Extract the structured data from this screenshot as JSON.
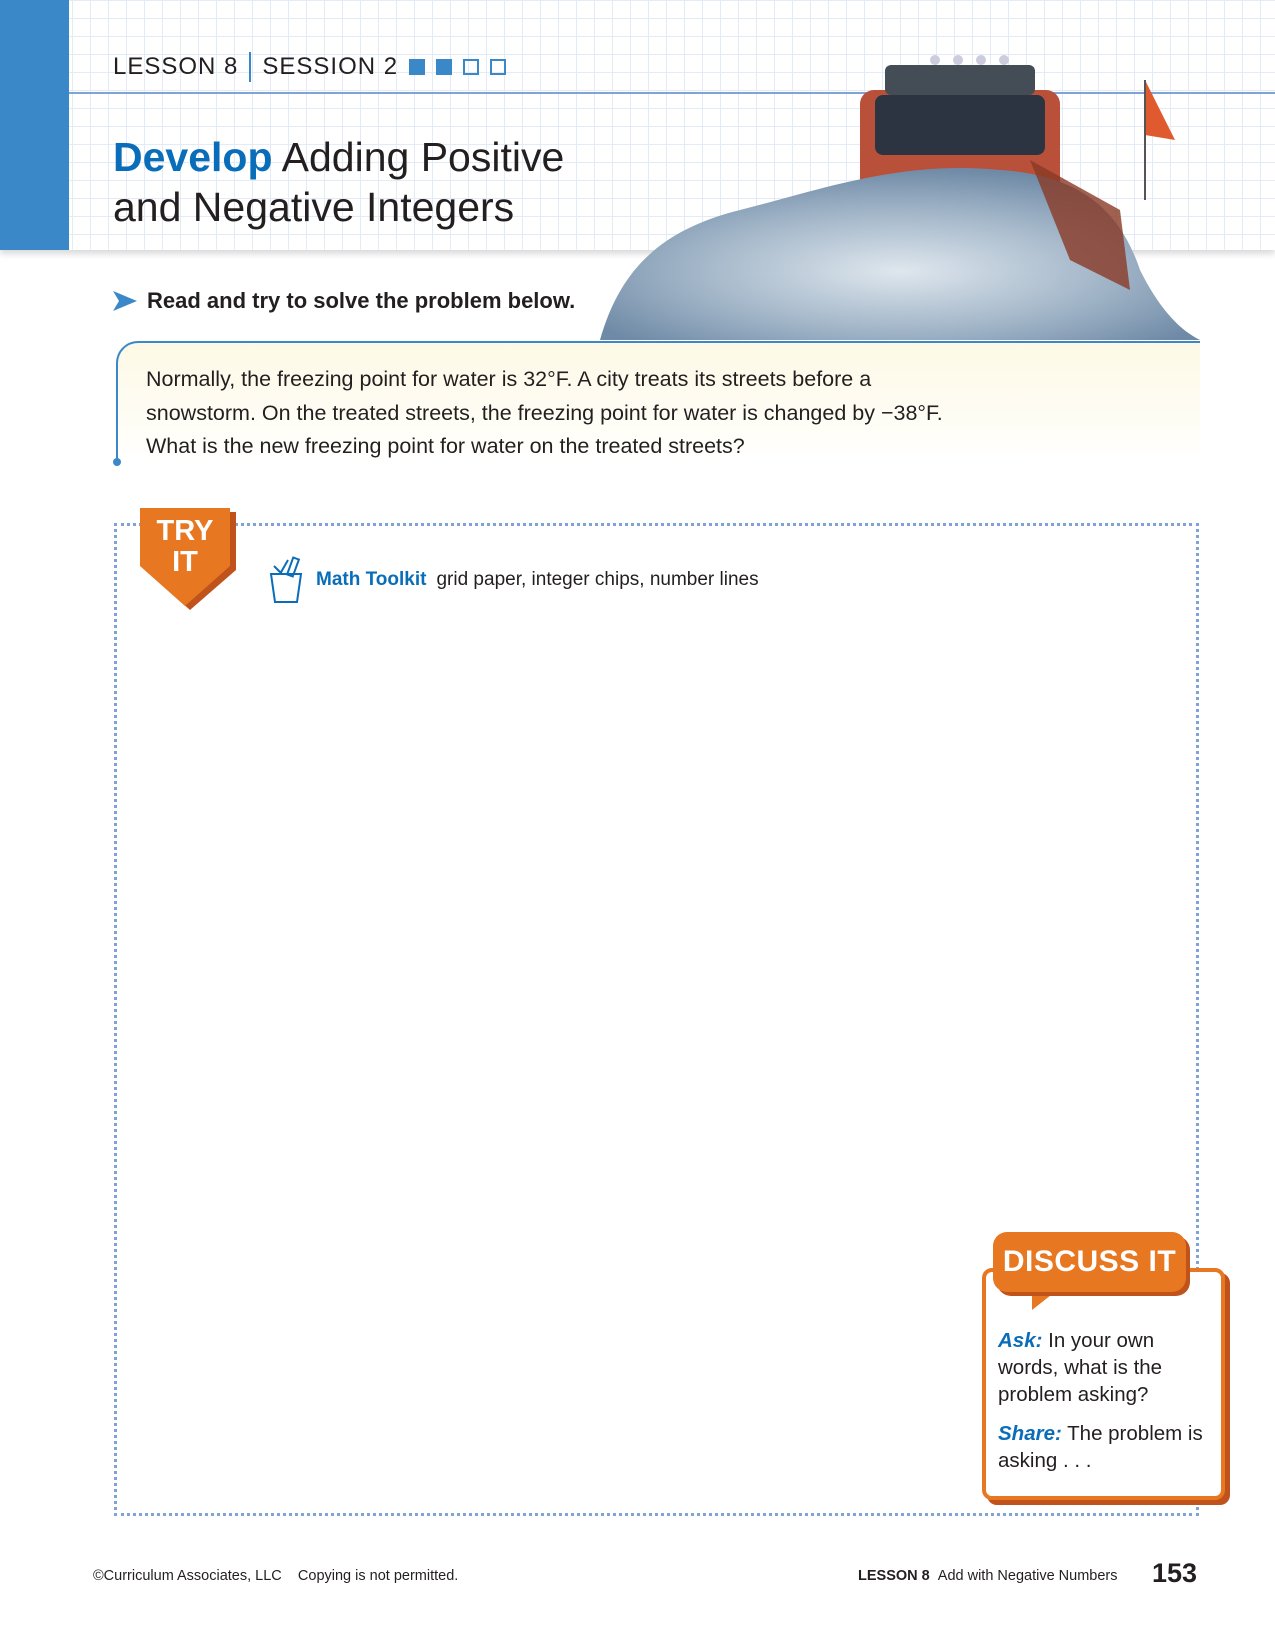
{
  "header": {
    "lesson": "LESSON 8",
    "session": "SESSION 2",
    "session_progress": {
      "completed": 2,
      "total": 4
    },
    "title_bold": "Develop",
    "title_line1": "Adding Positive",
    "title_line2": "and Negative Integers"
  },
  "instruction": "Read and try to solve the problem below.",
  "problem": {
    "line1": "Normally, the freezing point for water is 32°F. A city treats its streets before a",
    "line2": "snowstorm. On the treated streets, the freezing point for water is changed by −38°F.",
    "line3": "What is the new freezing point for water on the treated streets?"
  },
  "try_it": {
    "badge_line1": "TRY",
    "badge_line2": "IT",
    "toolkit_label": "Math Toolkit",
    "toolkit_items": "grid paper, integer chips, number lines"
  },
  "discuss": {
    "title": "DISCUSS IT",
    "ask_label": "Ask:",
    "ask_text": "In your own words, what is the problem asking?",
    "share_label": "Share:",
    "share_text": "The problem is asking . . ."
  },
  "footer": {
    "copyright": "©Curriculum Associates, LLC",
    "notice": "Copying is not permitted.",
    "lesson": "LESSON 8",
    "lesson_title": "Add with Negative Numbers",
    "page": "153"
  },
  "colors": {
    "blue": "#3a88c8",
    "orange": "#e87722"
  }
}
